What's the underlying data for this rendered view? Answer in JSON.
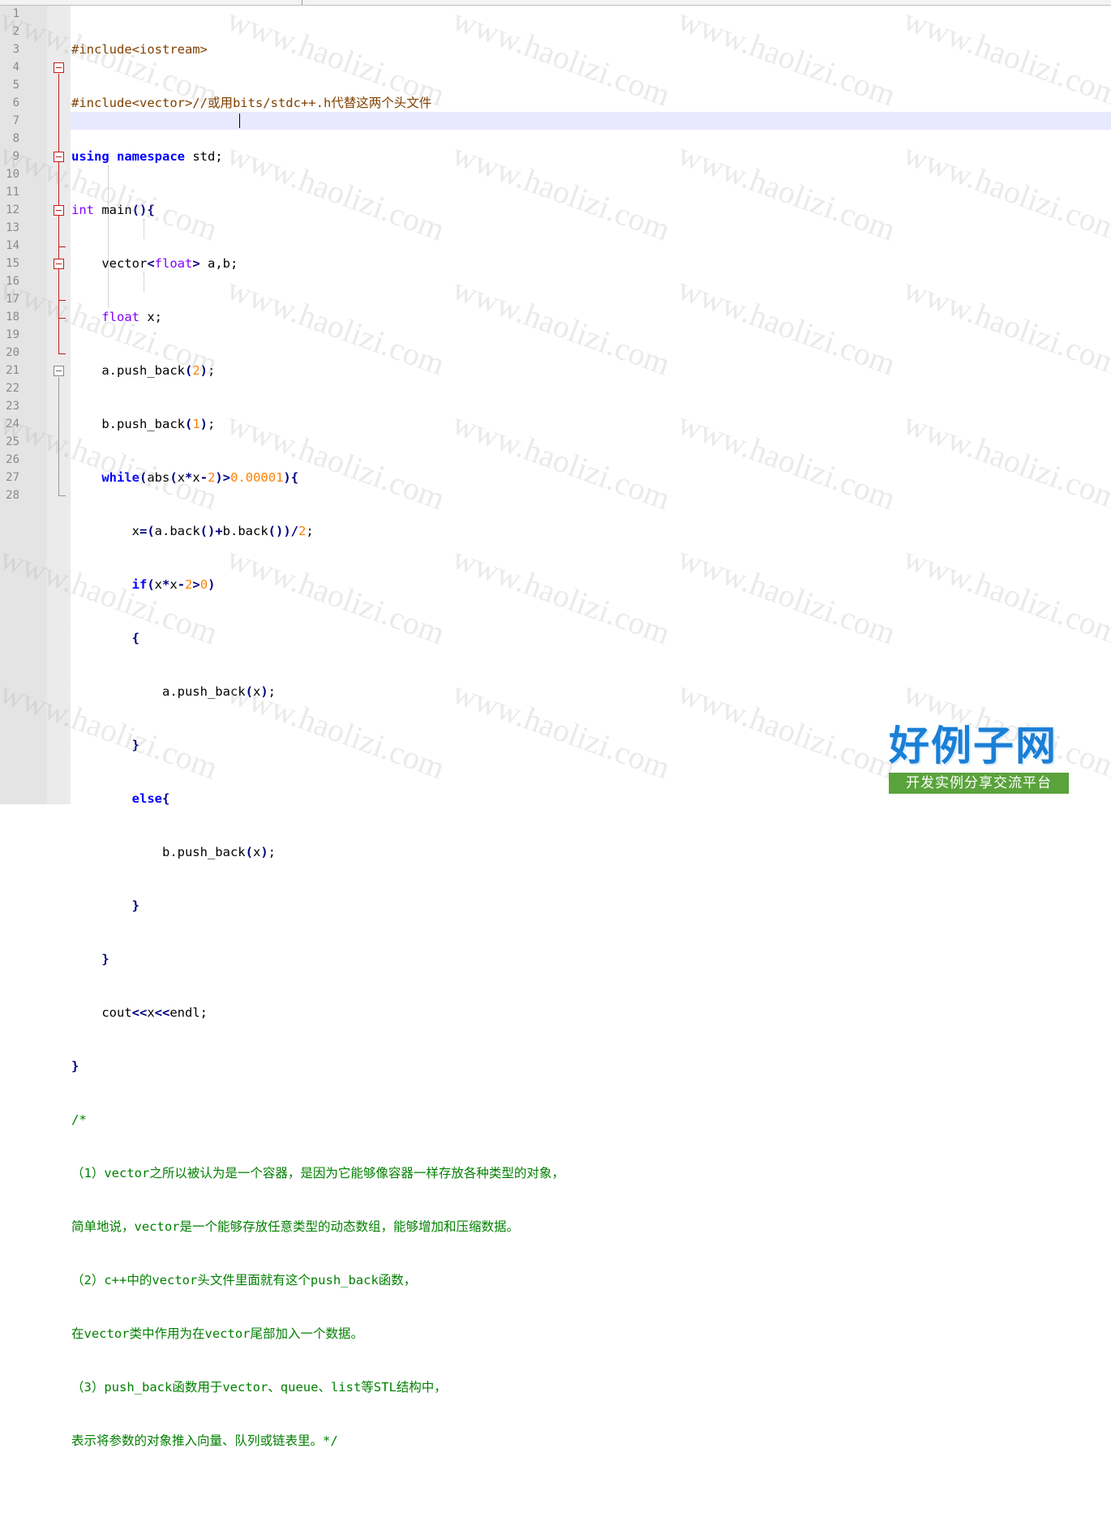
{
  "editor": {
    "line_numbers": [
      "1",
      "2",
      "3",
      "4",
      "5",
      "6",
      "7",
      "8",
      "9",
      "10",
      "11",
      "12",
      "13",
      "14",
      "15",
      "16",
      "17",
      "18",
      "19",
      "20",
      "21",
      "22",
      "23",
      "24",
      "25",
      "26",
      "27",
      "28"
    ],
    "code": {
      "l1": "#include<iostream>",
      "l2": "#include<vector>//或用bits/stdc++.h代替这两个头文件",
      "l3_kw1": "using",
      "l3_kw2": "namespace",
      "l3_rest": " std;",
      "l4_ty": "int",
      "l4_rest": " main",
      "l5_a": "vector",
      "l5_ty": "float",
      "l5_b": " a,b;",
      "l6_ty": "float",
      "l6_rest": " x;",
      "l7_a": "a.push_back",
      "l7_n": "2",
      "l8_a": "b.push_back",
      "l8_n": "1",
      "l9_kw": "while",
      "l9_a": "abs",
      "l9_b": "x",
      "l9_c": "x",
      "l9_n1": "2",
      "l9_n2": "0.00001",
      "l10_a": "x",
      "l10_b": "a.back",
      "l10_c": "b.back",
      "l10_n": "2",
      "l11_kw": "if",
      "l11_a": "x",
      "l11_b": "x",
      "l11_n1": "2",
      "l11_n2": "0",
      "l13": "a.push_back",
      "l13_x": "x",
      "l15_kw": "else",
      "l16": "b.push_back",
      "l16_x": "x",
      "l19_a": "cout",
      "l19_b": "x",
      "l19_c": "endl",
      "c21": "/*",
      "c22": "（1）vector之所以被认为是一个容器，是因为它能够像容器一样存放各种类型的对象，",
      "c23": "简单地说，vector是一个能够存放任意类型的动态数组，能够增加和压缩数据。",
      "c24": "（2）c++中的vector头文件里面就有这个push_back函数，",
      "c25": "在vector类中作用为在vector尾部加入一个数据。",
      "c26": "（3）push_back函数用于vector、queue、list等STL结构中，",
      "c27": "表示将参数的对象推入向量、队列或链表里。*/"
    }
  },
  "watermark": "www.haolizi.com",
  "logo": {
    "title": "好例子网",
    "subtitle": "开发实例分享交流平台"
  },
  "colors": {
    "keyword": "#0000ff",
    "type": "#8000ff",
    "number": "#ff8000",
    "preprocessor": "#804000",
    "comment": "#008000",
    "operator": "#000080",
    "current_line": "#e8e8ff"
  }
}
